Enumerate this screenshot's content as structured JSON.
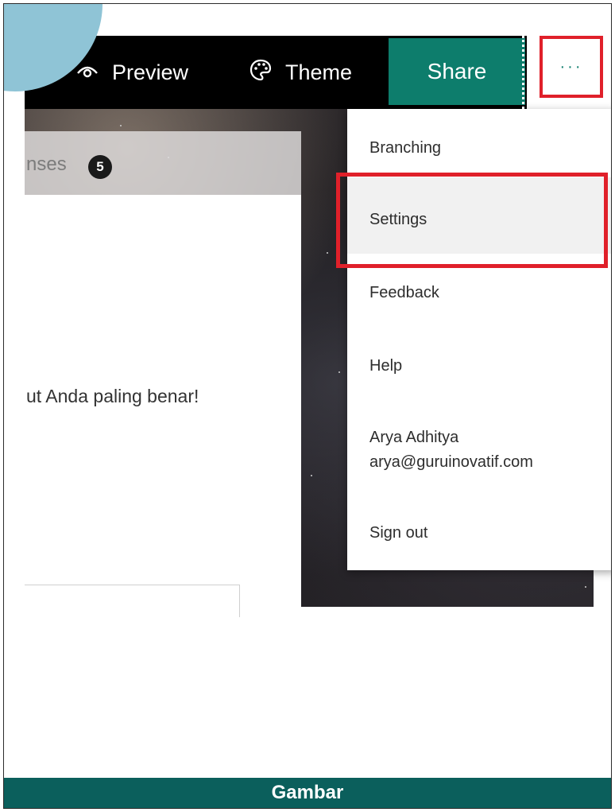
{
  "toolbar": {
    "preview_label": "Preview",
    "theme_label": "Theme",
    "share_label": "Share",
    "more_label": "···"
  },
  "form": {
    "tab_partial_label": "nses",
    "responses_count": "5",
    "question_text_partial": "ut Anda paling benar!"
  },
  "menu": {
    "items": [
      {
        "label": "Branching"
      },
      {
        "label": "Settings"
      },
      {
        "label": "Feedback"
      },
      {
        "label": "Help"
      },
      {
        "label": "Arya Adhitya",
        "email": "arya@guruinovatif.com"
      },
      {
        "label": "Sign out"
      }
    ]
  },
  "footer": {
    "caption": "Gambar"
  },
  "colors": {
    "share_green": "#0d7d6c",
    "highlight_red": "#e0202a",
    "footer_teal": "#0b5f5c",
    "corner_blue": "#8fc4d6"
  },
  "icons": [
    "preview-eye-icon",
    "theme-palette-icon",
    "more-options-icon"
  ]
}
